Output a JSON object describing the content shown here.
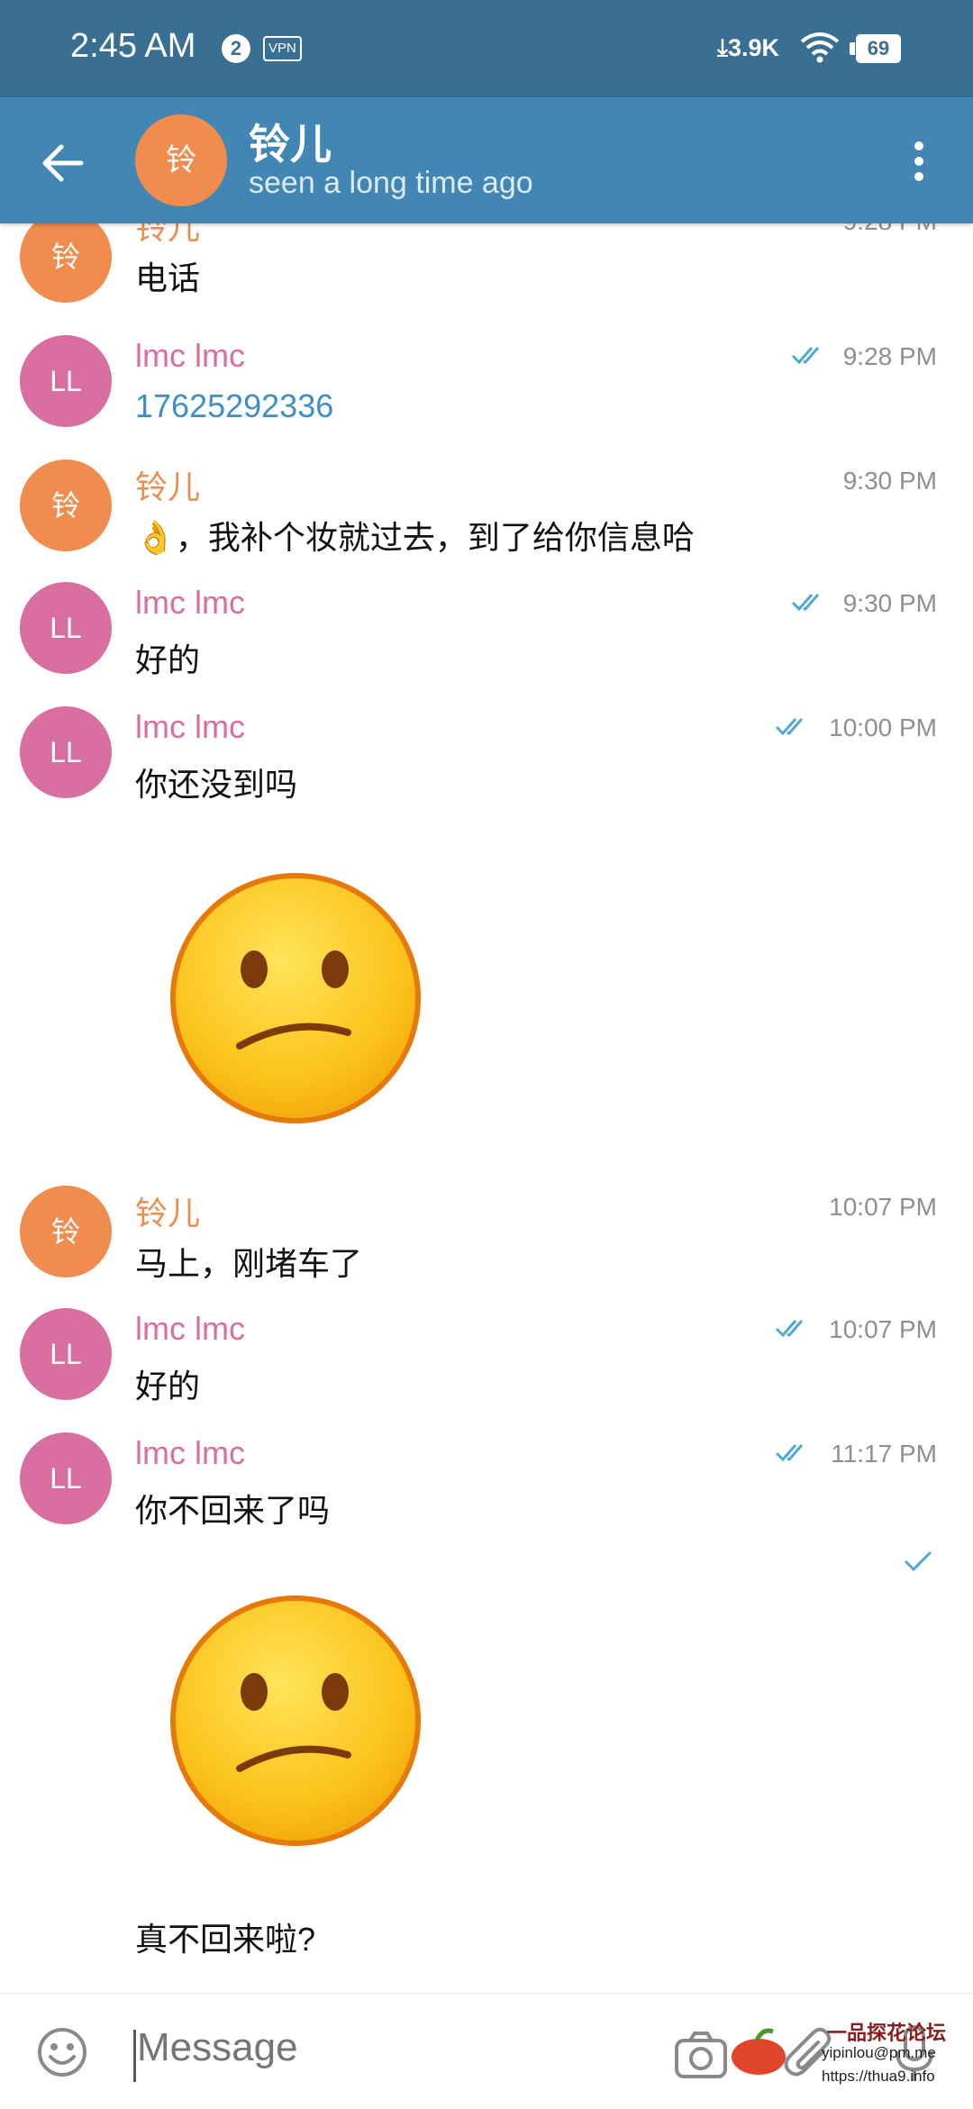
{
  "status_bar": {
    "time": "2:45 AM",
    "badge_count": "2",
    "vpn": "VPN",
    "network_speed": "3.9K",
    "battery": "69"
  },
  "header": {
    "avatar_initial": "铃",
    "title": "铃儿",
    "subtitle": "seen a long time ago"
  },
  "messages": [
    {
      "author": "铃儿",
      "avatar": "铃",
      "text": "电话",
      "time": "9:28 PM"
    },
    {
      "author": "lmc lmc",
      "avatar": "LL",
      "text": "17625292336",
      "time": "9:28 PM",
      "status": "read"
    },
    {
      "author": "铃儿",
      "avatar": "铃",
      "text": "👌，我补个妆就过去，到了给你信息哈",
      "time": "9:30 PM"
    },
    {
      "author": "lmc lmc",
      "avatar": "LL",
      "text": "好的",
      "time": "9:30 PM",
      "status": "read"
    },
    {
      "author": "lmc lmc",
      "avatar": "LL",
      "text": "你还没到吗",
      "time": "10:00 PM",
      "status": "read"
    },
    {
      "type": "sticker",
      "sticker": "confused-face"
    },
    {
      "author": "铃儿",
      "avatar": "铃",
      "text": "马上，刚堵车了",
      "time": "10:07 PM"
    },
    {
      "author": "lmc lmc",
      "avatar": "LL",
      "text": "好的",
      "time": "10:07 PM",
      "status": "read"
    },
    {
      "author": "lmc lmc",
      "avatar": "LL",
      "text": "你不回来了吗",
      "time": "11:17 PM",
      "status": "read"
    },
    {
      "type": "sticker",
      "sticker": "confused-face",
      "status": "sent"
    },
    {
      "text": "真不回来啦?"
    }
  ],
  "input": {
    "placeholder": "Message"
  },
  "watermark": {
    "title": "一品探花论坛",
    "line1": "yipinlou@pm.me",
    "line2": "https://thua9.info"
  },
  "colors": {
    "header": "#4286b4",
    "status_bar": "#3a6f94",
    "contact_avatar": "#f08c4e",
    "self_avatar": "#d96fa1",
    "link": "#3f8fc5",
    "check": "#4fa8d8"
  },
  "icons": [
    "back-arrow-icon",
    "more-vert-icon",
    "emoji-icon",
    "camera-icon",
    "paperclip-icon",
    "microphone-icon",
    "double-check-icon",
    "single-check-icon",
    "wifi-icon",
    "battery-icon",
    "download-icon"
  ]
}
